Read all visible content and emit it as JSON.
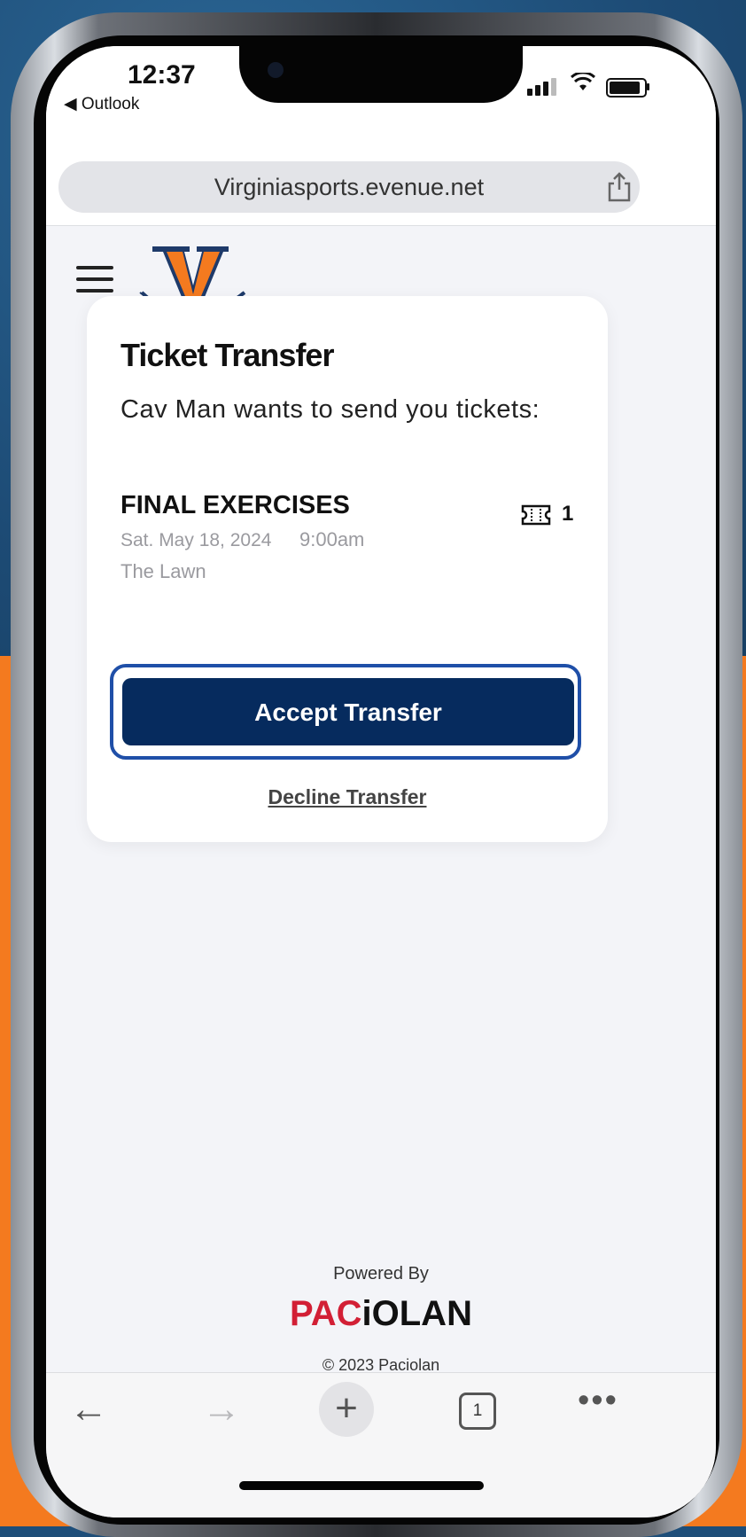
{
  "status_bar": {
    "time": "12:37",
    "back_app": "◀ Outlook"
  },
  "browser": {
    "url": "Virginiasports.evenue.net"
  },
  "card": {
    "title": "Ticket Transfer",
    "subtitle": "Cav Man wants to send you tickets:",
    "event": {
      "name": "FINAL EXERCISES",
      "date": "Sat. May 18, 2024",
      "time": "9:00am",
      "venue": "The Lawn",
      "ticket_count": "1"
    },
    "accept_label": "Accept Transfer",
    "decline_label": "Decline Transfer"
  },
  "footer": {
    "powered_by": "Powered By",
    "brand_part1": "PAC",
    "brand_part2": "iOLAN",
    "copyright": "© 2023 Paciolan"
  },
  "toolbar": {
    "tab_count": "1"
  },
  "colors": {
    "accept_button": "#062b5e",
    "accept_outline": "#1f4fa8",
    "brand_red": "#d21f35",
    "logo_orange": "#f47a1f",
    "logo_navy": "#1e3a6a"
  },
  "icons": {
    "menu": "hamburger-icon",
    "share": "share-icon",
    "ticket": "ticket-icon",
    "back": "arrow-left-icon",
    "forward": "arrow-right-icon",
    "new_tab": "plus-icon",
    "tabs": "tabs-icon",
    "more": "more-icon"
  }
}
